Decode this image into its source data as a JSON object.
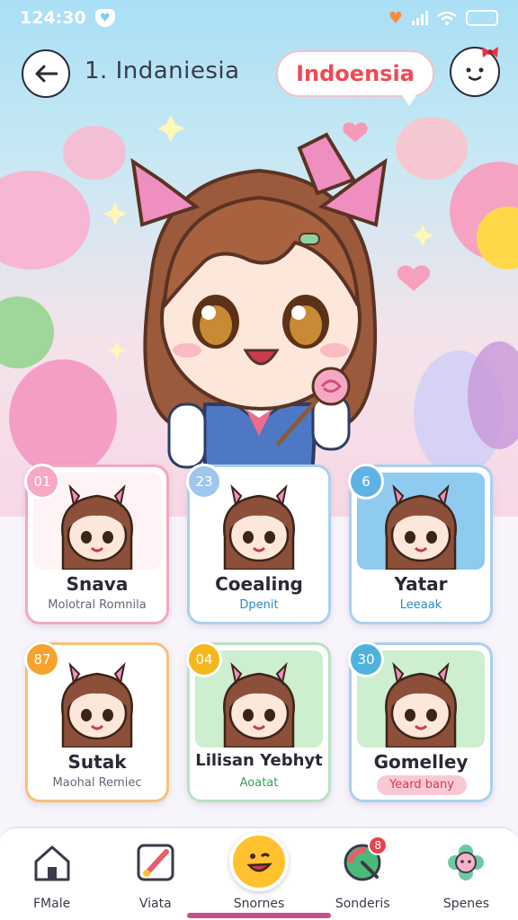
{
  "status_bar": {
    "time": "124:30",
    "signal_bars": 4,
    "battery_level": 0.8
  },
  "header": {
    "title": "1. Indaniesia",
    "country": "Indoensia"
  },
  "cards": [
    {
      "badge": "01",
      "name": "Snava",
      "subtitle": "Molotral Romnila",
      "accent": "#f2a9bf",
      "badge_color": "#f7a8c2",
      "art_bg": "#fff3f6"
    },
    {
      "badge": "23",
      "name": "Coealing",
      "subtitle": "Dpenit",
      "accent": "#a9d1ec",
      "badge_color": "#9fc6ec",
      "art_bg": "#ffffff"
    },
    {
      "badge": "6",
      "name": "Yatar",
      "subtitle": "Leeaak",
      "accent": "#a9d1ec",
      "badge_color": "#5fb3e4",
      "art_bg": "#8fcbee"
    },
    {
      "badge": "87",
      "name": "Sutak",
      "subtitle": "Maohal Remiec",
      "accent": "#f5c27a",
      "badge_color": "#f5a32c",
      "art_bg": "#ffffff"
    },
    {
      "badge": "04",
      "name": "Lilisan Yebhyt",
      "subtitle": "Aoatat",
      "accent": "#b8e2c4",
      "badge_color": "#f5b71e",
      "art_bg": "#cdeecf"
    },
    {
      "badge": "30",
      "name": "Gomelley",
      "subtitle": "Yeard bany",
      "accent": "#a9d1ec",
      "badge_color": "#4fb2dc",
      "art_bg": "#cdeecf"
    }
  ],
  "nav": [
    {
      "label": "FMale",
      "icon": "home-icon"
    },
    {
      "label": "Viata",
      "icon": "paint-brush-icon"
    },
    {
      "label": "Snornes",
      "icon": "smiley-icon"
    },
    {
      "label": "Sonderis",
      "icon": "palette-icon",
      "badge": "8"
    },
    {
      "label": "Spenes",
      "icon": "flower-face-icon"
    }
  ]
}
